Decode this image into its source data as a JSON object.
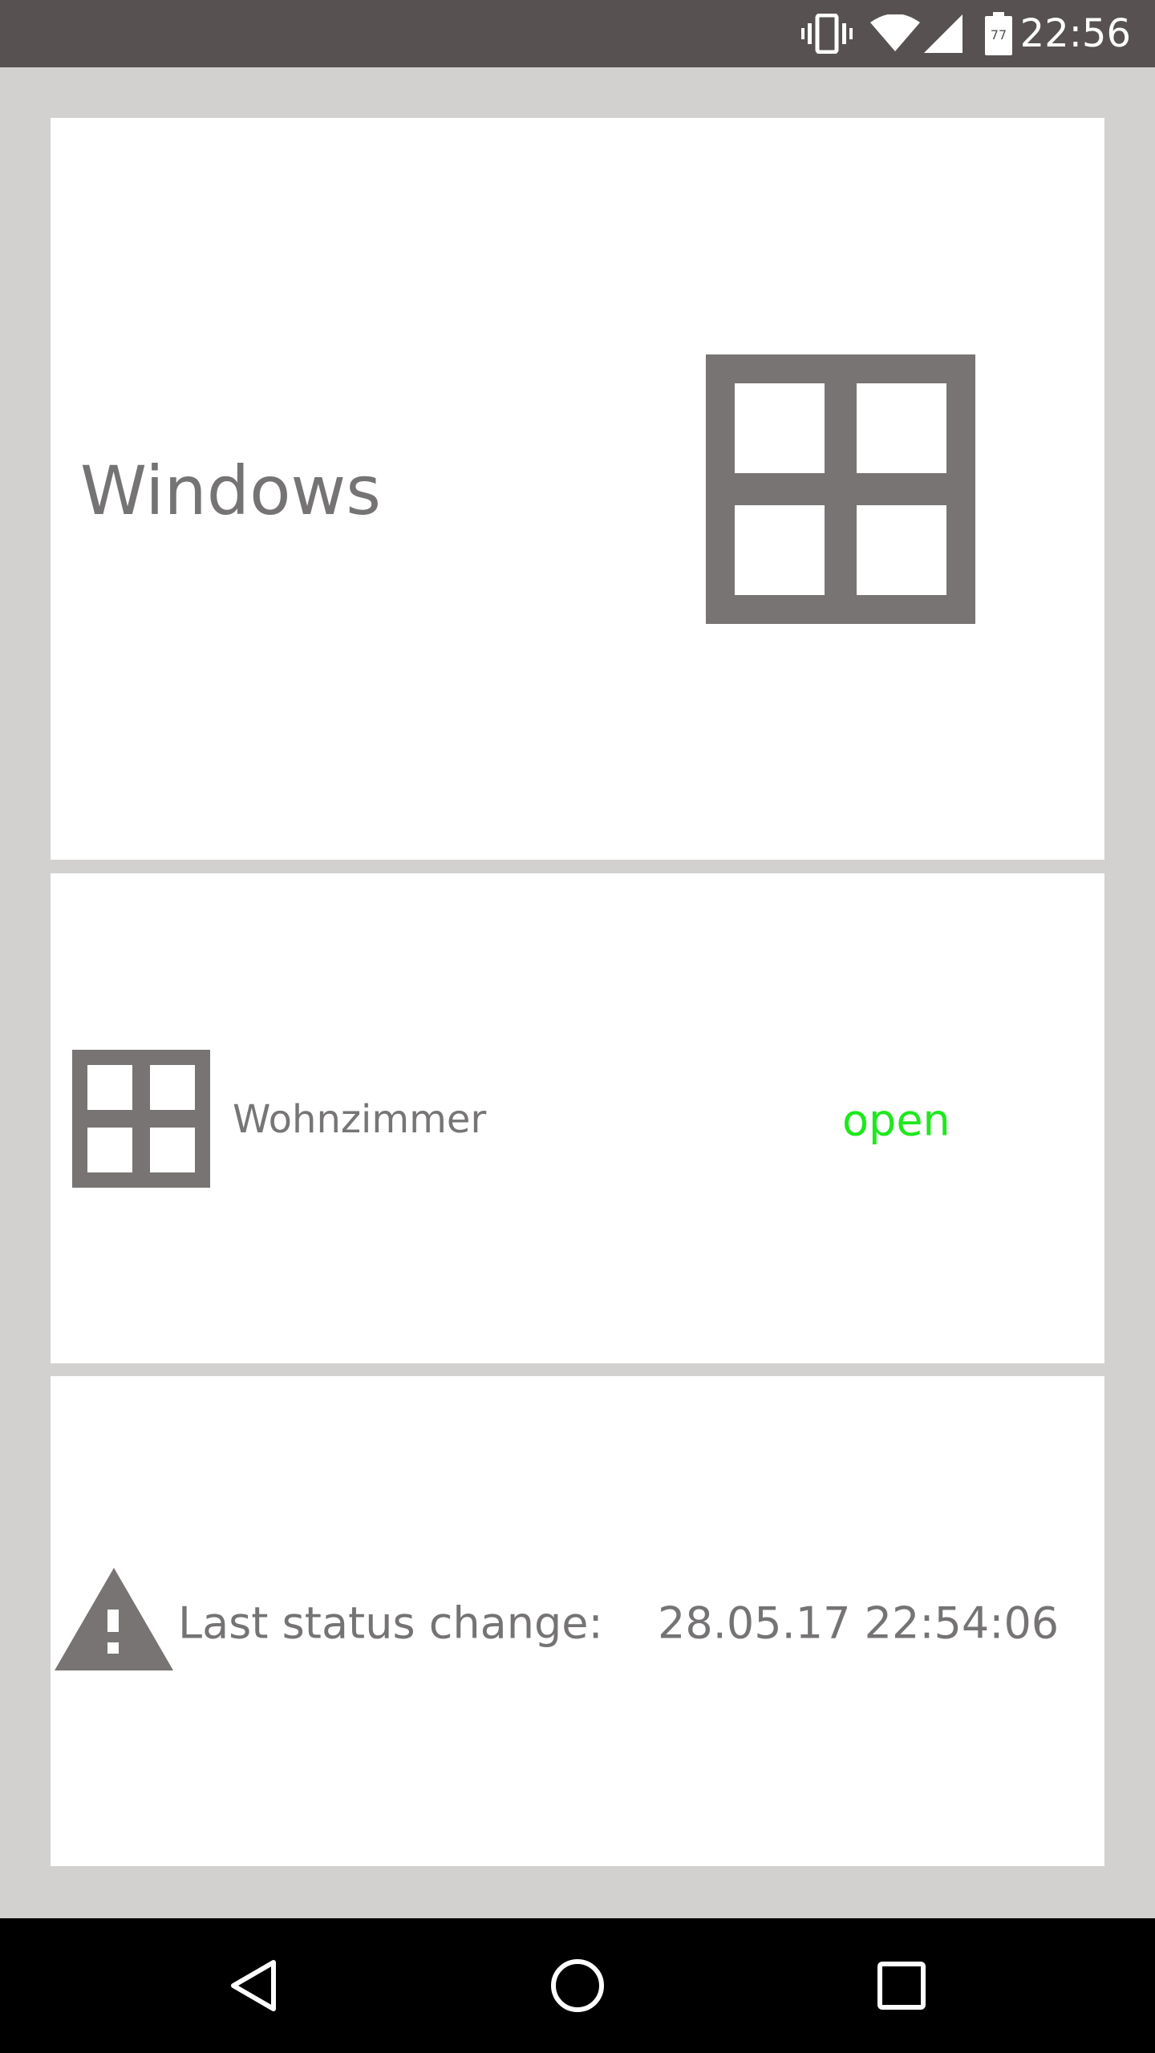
{
  "status_bar": {
    "time": "22:56",
    "battery_level": "77",
    "icons": [
      "vibrate-icon",
      "wifi-icon",
      "cellular-signal-icon",
      "battery-icon"
    ]
  },
  "windows_card": {
    "title": "Windows",
    "icon": "window-icon"
  },
  "room_card": {
    "room_name": "Wohnzimmer",
    "status": "open",
    "status_color": "#1ee81e",
    "icon": "window-icon"
  },
  "last_change_card": {
    "label": "Last status change:",
    "value": "28.05.17 22:54:06",
    "icon": "warning-icon"
  },
  "nav_bar": {
    "buttons": [
      "back-icon",
      "home-icon",
      "recents-icon"
    ]
  },
  "colors": {
    "background": "#d2d1d0",
    "card": "#ffffff",
    "icon_gray": "#787474",
    "text_gray": "#767374",
    "status_bar": "#575151",
    "nav_bar": "#000000"
  }
}
